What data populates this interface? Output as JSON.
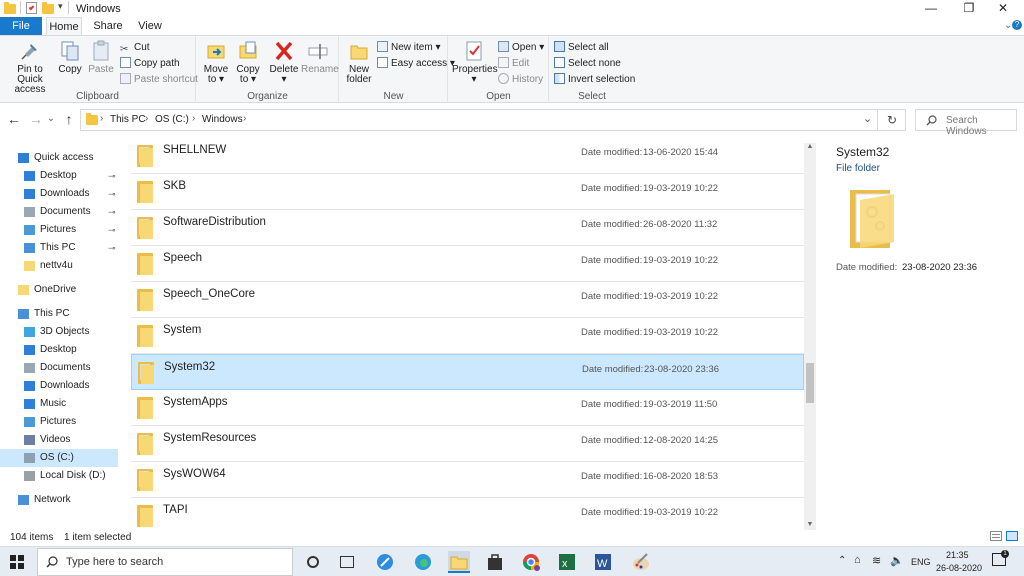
{
  "window": {
    "title": "Windows",
    "minimize_glyph": "—",
    "maximize_glyph": "❐",
    "close_glyph": "✕"
  },
  "ribbon_tabs": {
    "file": "File",
    "home": "Home",
    "share": "Share",
    "view": "View"
  },
  "ribbon": {
    "clipboard": {
      "label": "Clipboard",
      "pin": "Pin to Quick\naccess",
      "pin_l1": "Pin to Quick",
      "pin_l2": "access",
      "copy": "Copy",
      "paste": "Paste",
      "cut": "Cut",
      "copy_path": "Copy path",
      "paste_shortcut": "Paste shortcut"
    },
    "organize": {
      "label": "Organize",
      "move_to_l1": "Move",
      "move_to_l2": "to ▾",
      "copy_to_l1": "Copy",
      "copy_to_l2": "to ▾",
      "delete_l1": "Delete",
      "delete_l2": "▾",
      "rename": "Rename"
    },
    "new": {
      "label": "New",
      "new_folder_l1": "New",
      "new_folder_l2": "folder",
      "new_item": "New item ▾",
      "easy_access": "Easy access ▾"
    },
    "open": {
      "label": "Open",
      "properties_l1": "Properties",
      "properties_l2": "▾",
      "open": "Open ▾",
      "edit": "Edit",
      "history": "History"
    },
    "select": {
      "label": "Select",
      "select_all": "Select all",
      "select_none": "Select none",
      "invert": "Invert selection"
    }
  },
  "address": {
    "back": "←",
    "forward": "→",
    "recent": "⌄",
    "up": "↑",
    "crumbs": [
      "This PC",
      "OS (C:)",
      "Windows"
    ],
    "sep": "›",
    "dropdown": "⌄",
    "refresh": "↻",
    "search_placeholder": "Search Windows"
  },
  "nav": {
    "quick_access": "Quick access",
    "quick_items": [
      "Desktop",
      "Downloads",
      "Documents",
      "Pictures",
      "This PC",
      "nettv4u"
    ],
    "onedrive": "OneDrive",
    "this_pc": "This PC",
    "pc_items": [
      "3D Objects",
      "Desktop",
      "Documents",
      "Downloads",
      "Music",
      "Pictures",
      "Videos",
      "OS (C:)",
      "Local Disk (D:)"
    ],
    "network": "Network",
    "pin_glyph": "📌"
  },
  "files": {
    "date_label": "Date modified:",
    "rows": [
      {
        "name": "SHELLNEW",
        "date": "13-06-2020 15:44",
        "paper": true
      },
      {
        "name": "SKB",
        "date": "19-03-2019 10:22",
        "paper": false
      },
      {
        "name": "SoftwareDistribution",
        "date": "26-08-2020 11:32",
        "paper": true
      },
      {
        "name": "Speech",
        "date": "19-03-2019 10:22",
        "paper": false
      },
      {
        "name": "Speech_OneCore",
        "date": "19-03-2019 10:22",
        "paper": false
      },
      {
        "name": "System",
        "date": "19-03-2019 10:22",
        "paper": false
      },
      {
        "name": "System32",
        "date": "23-08-2020 23:36",
        "paper": true,
        "selected": true
      },
      {
        "name": "SystemApps",
        "date": "19-03-2019 11:50",
        "paper": false
      },
      {
        "name": "SystemResources",
        "date": "12-08-2020 14:25",
        "paper": true
      },
      {
        "name": "SysWOW64",
        "date": "16-08-2020 18:53",
        "paper": true
      },
      {
        "name": "TAPI",
        "date": "19-03-2019 10:22",
        "paper": false
      }
    ]
  },
  "preview": {
    "name": "System32",
    "type": "File folder",
    "date_label": "Date modified:",
    "date": "23-08-2020 23:36"
  },
  "status": {
    "items": "104 items",
    "selected": "1 item selected"
  },
  "taskbar": {
    "search_placeholder": "Type here to search",
    "lang": "ENG",
    "time": "21:35",
    "date": "26-08-2020"
  },
  "colors": {
    "accent": "#1979ca",
    "selection": "#cce8ff",
    "folder": "#f8d775"
  }
}
